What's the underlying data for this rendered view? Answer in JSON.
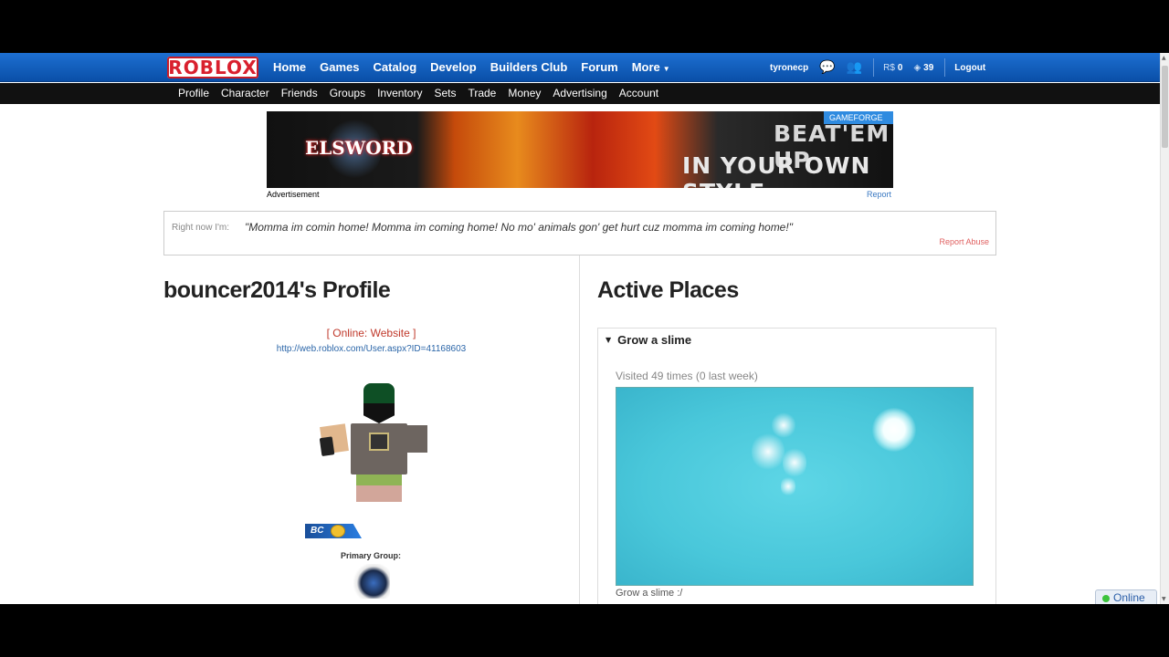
{
  "topnav": {
    "logo": "ROBLOX",
    "links": [
      "Home",
      "Games",
      "Catalog",
      "Develop",
      "Builders Club",
      "Forum",
      "More"
    ],
    "username": "tyronecp",
    "robux": "0",
    "tickets": "39",
    "logout": "Logout",
    "robux_label": "R$"
  },
  "subnav": {
    "links": [
      "Profile",
      "Character",
      "Friends",
      "Groups",
      "Inventory",
      "Sets",
      "Trade",
      "Money",
      "Advertising",
      "Account"
    ]
  },
  "ad": {
    "brand": "ELSWORD",
    "tagline1": "BEAT'EM UP",
    "tagline2": "IN YOUR OWN STYLE",
    "network": "GAMEFORGE",
    "label": "Advertisement",
    "report": "Report"
  },
  "status": {
    "label": "Right now I'm:",
    "message": "\"Momma im comin home! Momma im coming home! No mo' animals gon' get hurt cuz momma im coming home!\"",
    "report_abuse": "Report Abuse"
  },
  "profile": {
    "title": "bouncer2014's Profile",
    "online_prefix": "[ Online: ",
    "online_location": "Website",
    "online_suffix": " ]",
    "url": "http://web.roblox.com/User.aspx?ID=41168603",
    "badge": "BC",
    "primary_group_label": "Primary Group:"
  },
  "places": {
    "title": "Active Places",
    "items": [
      {
        "name": "Grow a slime",
        "visits": "Visited 49 times (0 last week)",
        "caption": "Grow a slime :/"
      }
    ]
  },
  "online_widget": "Online",
  "colors": {
    "nav_blue": "#0b5bbd",
    "subnav_black": "#111111",
    "online_red": "#c0392b",
    "link_blue": "#2a65a8",
    "thumb_cyan": "#49c7da"
  }
}
